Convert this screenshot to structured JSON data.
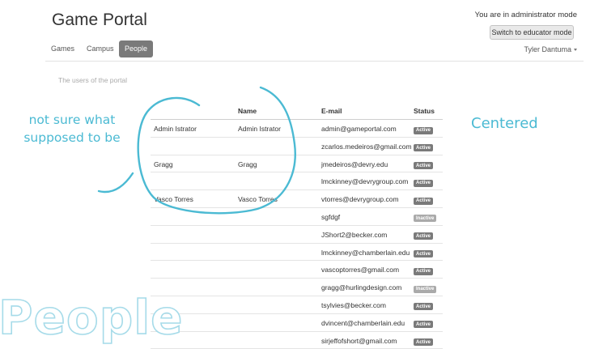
{
  "header": {
    "title": "Game Portal",
    "mode_text": "You are in administrator mode",
    "switch_button": "Switch to educator mode"
  },
  "nav": {
    "tabs": [
      {
        "label": "Games",
        "active": false
      },
      {
        "label": "Campus",
        "active": false
      },
      {
        "label": "People",
        "active": true
      }
    ],
    "user_menu": "Tyler Dantuma"
  },
  "main": {
    "subtitle": "The users of the portal",
    "table": {
      "headers": [
        "",
        "Name",
        "E-mail",
        "Status"
      ],
      "rows": [
        {
          "col1": "Admin Istrator",
          "name": "Admin Istrator",
          "email": "admin@gameportal.com",
          "status": "Active"
        },
        {
          "col1": "",
          "name": "",
          "email": "zcarlos.medeiros@gmail.com",
          "status": "Active"
        },
        {
          "col1": "Gragg",
          "name": "Gragg",
          "email": "jmedeiros@devry.edu",
          "status": "Active"
        },
        {
          "col1": "",
          "name": "",
          "email": "lmckinney@devrygroup.com",
          "status": "Active"
        },
        {
          "col1": "Vasco Torres",
          "name": "Vasco Torres",
          "email": "vtorres@devrygroup.com",
          "status": "Active"
        },
        {
          "col1": "",
          "name": "",
          "email": "sgfdgf",
          "status": "Inactive"
        },
        {
          "col1": "",
          "name": "",
          "email": "JShort2@becker.com",
          "status": "Active"
        },
        {
          "col1": "",
          "name": "",
          "email": "lmckinney@chamberlain.edu",
          "status": "Active"
        },
        {
          "col1": "",
          "name": "",
          "email": "vascoptorres@gmail.com",
          "status": "Active"
        },
        {
          "col1": "",
          "name": "",
          "email": "gragg@hurlingdesign.com",
          "status": "Inactive"
        },
        {
          "col1": "",
          "name": "",
          "email": "tsylvies@becker.com",
          "status": "Active"
        },
        {
          "col1": "",
          "name": "",
          "email": "dvincent@chamberlain.edu",
          "status": "Active"
        },
        {
          "col1": "",
          "name": "",
          "email": "sirjeffofshort@gmail.com",
          "status": "Active"
        }
      ]
    }
  },
  "annotations": {
    "note": "not sure what supposed to be",
    "centered": "Centered",
    "watermark": "People",
    "color": "#4bbad3"
  }
}
